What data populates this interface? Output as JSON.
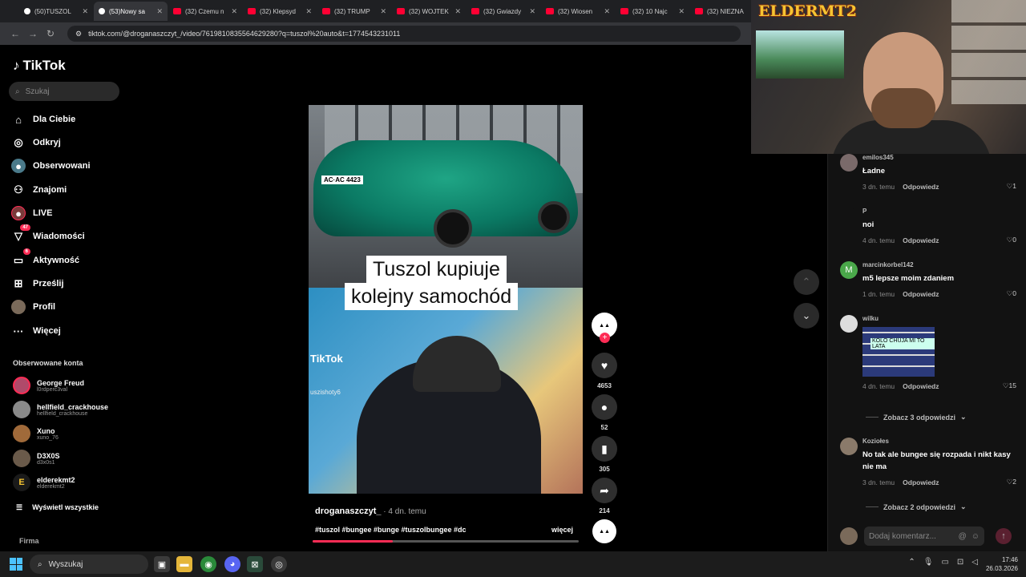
{
  "browser": {
    "tabs": [
      {
        "label": "(50)TUSZOL",
        "icon": "tiktok-icon",
        "active": false
      },
      {
        "label": "(53)Nowy sa",
        "icon": "tiktok-icon",
        "active": true
      },
      {
        "label": "(32) Czemu n",
        "icon": "youtube-icon",
        "active": false
      },
      {
        "label": "(32) Klepsyd",
        "icon": "youtube-icon",
        "active": false
      },
      {
        "label": "(32) TRUMP",
        "icon": "youtube-icon",
        "active": false
      },
      {
        "label": "(32) WOJTEK",
        "icon": "youtube-icon",
        "active": false
      },
      {
        "label": "(32) Gwiazdy",
        "icon": "youtube-icon",
        "active": false
      },
      {
        "label": "(32) Wiosen",
        "icon": "youtube-icon",
        "active": false
      },
      {
        "label": "(32) 10 Najc",
        "icon": "youtube-icon",
        "active": false
      },
      {
        "label": "(32) NIEZNA",
        "icon": "youtube-icon",
        "active": false
      }
    ],
    "url": "tiktok.com/@droganaszczyt_/video/7619810835564629280?q=tuszol%20auto&t=1774543231011"
  },
  "sidebar": {
    "logo": "TikTok",
    "search_placeholder": "Szukaj",
    "nav": [
      {
        "label": "Dla Ciebie",
        "icon": "home-icon"
      },
      {
        "label": "Odkryj",
        "icon": "compass-icon"
      },
      {
        "label": "Obserwowani",
        "icon": "following-icon"
      },
      {
        "label": "Znajomi",
        "icon": "friends-icon"
      },
      {
        "label": "LIVE",
        "icon": "live-icon"
      },
      {
        "label": "Wiadomości",
        "icon": "messages-icon",
        "badge": "47"
      },
      {
        "label": "Aktywność",
        "icon": "activity-icon",
        "badge": "6"
      },
      {
        "label": "Prześlij",
        "icon": "upload-icon"
      },
      {
        "label": "Profil",
        "icon": "profile-icon"
      },
      {
        "label": "Więcej",
        "icon": "more-icon"
      }
    ],
    "followed_header": "Obserwowane konta",
    "followed": [
      {
        "name": "George Freud",
        "handle": "l0rdperc3val"
      },
      {
        "name": "hellfield_crackhouse",
        "handle": "hellfield_crackhouse"
      },
      {
        "name": "Xuno",
        "handle": "xuno_76"
      },
      {
        "name": "D3X0S",
        "handle": "d3x0s1"
      },
      {
        "name": "elderekmt2",
        "handle": "elderekmt2"
      }
    ],
    "see_all": "Wyświetl wszystkie",
    "footer": "Firma"
  },
  "video": {
    "caption_line1": "Tuszol kupiuje",
    "caption_line2": "kolejny samochód",
    "plate": "AC·AC 4423",
    "watermark": "TikTok",
    "watermark_handle": "uszishoty6",
    "author": "droganaszczyt_",
    "posted": " · 4 dn. temu",
    "tags": "#tuszol #bungee #bunge #tuszolbungee #dc",
    "more": "więcej",
    "progress": 0.3
  },
  "actions": {
    "likes": "4653",
    "comments": "52",
    "saves": "305",
    "shares": "214"
  },
  "overlay": {
    "logo_text": "ELDERMT2"
  },
  "comments": [
    {
      "user": "emilos345",
      "text": "Ładne",
      "time": "3 dn. temu",
      "reply": "Odpowiedz",
      "likes": "1"
    },
    {
      "user": "P",
      "text": "noi",
      "time": "4 dn. temu",
      "reply": "Odpowiedz",
      "likes": "0"
    },
    {
      "user": "marcinkorbel142",
      "text": "m5 lepsze moim zdaniem",
      "time": "1 dn. temu",
      "reply": "Odpowiedz",
      "likes": "0"
    },
    {
      "user": "wilku",
      "text": "",
      "gif_text": "KOLO CHUJA MI TO LATA",
      "time": "4 dn. temu",
      "reply": "Odpowiedz",
      "likes": "15"
    },
    {
      "user": "Koziołes",
      "text": "No tak ale bungee się rozpada i nikt kasy nie ma",
      "time": "3 dn. temu",
      "reply": "Odpowiedz",
      "likes": "2"
    }
  ],
  "see_replies_1": "Zobacz 3 odpowiedzi",
  "see_replies_2": "Zobacz 2 odpowiedzi",
  "add_comment_placeholder": "Dodaj komentarz...",
  "taskbar": {
    "search_label": "Wyszukaj",
    "time": "17:46",
    "date": "26.03.2026"
  }
}
